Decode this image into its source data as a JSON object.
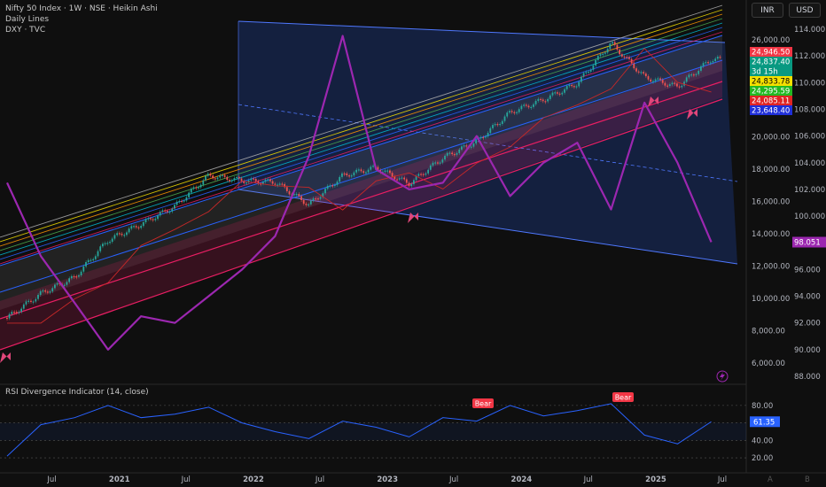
{
  "header": {
    "symbol_line": "Nifty 50 Index · 1W · NSE · Heikin Ashi",
    "indicator_1": "Daily Lines",
    "indicator_2": "DXY · TVC"
  },
  "currency_buttons": [
    "INR",
    "USD"
  ],
  "rsi_panel": {
    "title": "RSI Divergence Indicator (14, close)",
    "current_value": "61.35",
    "bear_label": "Bear",
    "levels": [
      "80.00",
      "60.00",
      "40.00",
      "20.00"
    ]
  },
  "axes": {
    "price_ticks": [
      "26,000.00",
      "20,000.00",
      "18,000.00",
      "16,000.00",
      "14,000.00",
      "12,000.00",
      "10,000.00",
      "8,000.00",
      "6,000.00"
    ],
    "dxy_ticks": [
      "114.000",
      "112.000",
      "110.000",
      "108.000",
      "106.000",
      "104.000",
      "102.000",
      "100.000",
      "98.000",
      "96.000",
      "94.000",
      "92.000",
      "90.000",
      "88.000"
    ],
    "time_ticks": [
      "Jul",
      "2021",
      "Jul",
      "2022",
      "Jul",
      "2023",
      "Jul",
      "2024",
      "Jul",
      "2025",
      "Jul"
    ]
  },
  "price_labels": [
    {
      "text": "24,946.50",
      "color": "#f23645"
    },
    {
      "text": "24,837.40",
      "color": "#089981"
    },
    {
      "text": "3d 15h",
      "color": "#089981"
    },
    {
      "text": "24,833.78",
      "color": "#f5e000"
    },
    {
      "text": "24,295.59",
      "color": "#22b822"
    },
    {
      "text": "24,085.11",
      "color": "#e02424"
    },
    {
      "text": "23,648.40",
      "color": "#1f2fd9"
    }
  ],
  "dxy_label": {
    "text": "98.051",
    "color": "#9c27b0"
  },
  "corner_marks": [
    "A",
    "B"
  ],
  "colors": {
    "nifty_up": "#26a69a",
    "nifty_down": "#ef5350",
    "dxy": "#9c27b0",
    "rsi": "#2962ff",
    "channel": "#2962ff"
  },
  "chart_data": {
    "type": "line",
    "x_range": [
      "2020-03",
      "2025-07"
    ],
    "series": [
      {
        "name": "Nifty 50 Index",
        "ylim": [
          6000,
          26000
        ],
        "x": [
          "2020-03",
          "2020-06",
          "2020-09",
          "2020-12",
          "2021-03",
          "2021-06",
          "2021-09",
          "2021-12",
          "2022-03",
          "2022-06",
          "2022-09",
          "2022-12",
          "2023-03",
          "2023-06",
          "2023-09",
          "2023-12",
          "2024-03",
          "2024-06",
          "2024-09",
          "2024-12",
          "2025-03",
          "2025-06"
        ],
        "values": [
          8800,
          10300,
          11300,
          13600,
          14600,
          15700,
          17600,
          17300,
          17200,
          15800,
          17600,
          18100,
          17100,
          18700,
          19700,
          21500,
          22300,
          23300,
          25800,
          23700,
          23100,
          24800
        ]
      },
      {
        "name": "DXY",
        "ylim": [
          88,
          114
        ],
        "x": [
          "2020-03",
          "2020-06",
          "2020-09",
          "2020-12",
          "2021-03",
          "2021-06",
          "2021-09",
          "2021-12",
          "2022-03",
          "2022-06",
          "2022-09",
          "2022-12",
          "2023-03",
          "2023-06",
          "2023-09",
          "2023-12",
          "2024-03",
          "2024-06",
          "2024-09",
          "2024-12",
          "2025-03",
          "2025-06"
        ],
        "values": [
          102.5,
          97.0,
          93.5,
          90.0,
          92.5,
          92.0,
          94.0,
          96.0,
          98.5,
          104.5,
          113.5,
          103.5,
          102.0,
          102.5,
          106.0,
          101.5,
          104.0,
          105.5,
          100.5,
          108.5,
          104.0,
          98.05
        ]
      },
      {
        "name": "RSI Divergence Indicator (14, close)",
        "ylim": [
          15,
          90
        ],
        "x": [
          "2020-03",
          "2020-06",
          "2020-09",
          "2020-12",
          "2021-03",
          "2021-06",
          "2021-09",
          "2021-12",
          "2022-03",
          "2022-06",
          "2022-09",
          "2022-12",
          "2023-03",
          "2023-06",
          "2023-09",
          "2023-12",
          "2024-03",
          "2024-06",
          "2024-09",
          "2024-12",
          "2025-03",
          "2025-06"
        ],
        "values": [
          22,
          58,
          66,
          80,
          66,
          70,
          78,
          60,
          50,
          42,
          62,
          55,
          44,
          66,
          62,
          80,
          68,
          74,
          82,
          46,
          36,
          61.35
        ]
      }
    ]
  }
}
